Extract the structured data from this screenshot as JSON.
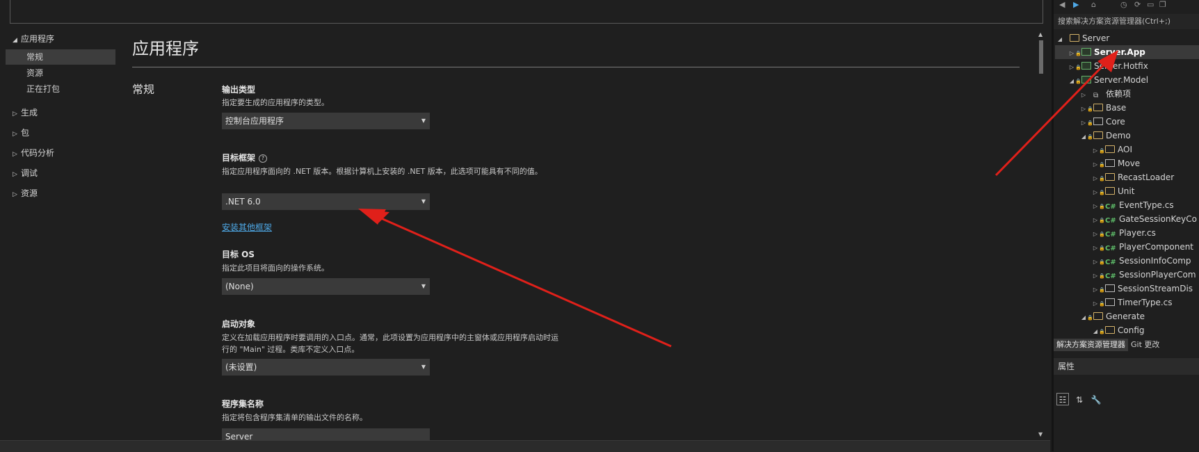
{
  "nav": {
    "app": "应用程序",
    "app_items": [
      "常规",
      "资源",
      "正在打包"
    ],
    "groups": [
      "生成",
      "包",
      "代码分析",
      "调试",
      "资源"
    ]
  },
  "content": {
    "page_title": "应用程序",
    "section_title": "常规",
    "output_type_label": "输出类型",
    "output_type_desc": "指定要生成的应用程序的类型。",
    "output_type_value": "控制台应用程序",
    "target_fw_label": "目标框架",
    "target_fw_desc": "指定应用程序面向的 .NET 版本。根据计算机上安装的 .NET 版本，此选项可能具有不同的值。",
    "target_fw_value": ".NET 6.0",
    "install_link": "安装其他框架",
    "target_os_label": "目标 OS",
    "target_os_desc": "指定此项目将面向的操作系统。",
    "target_os_value": "(None)",
    "startup_label": "启动对象",
    "startup_desc": "定义在加载应用程序时要调用的入口点。通常，此项设置为应用程序中的主窗体或应用程序启动时运行的 \"Main\" 过程。类库不定义入口点。",
    "startup_value": "(未设置)",
    "assembly_label": "程序集名称",
    "assembly_desc": "指定将包含程序集清单的输出文件的名称。",
    "assembly_value": "Server"
  },
  "solution": {
    "search_placeholder": "搜索解决方案资源管理器(Ctrl+;)",
    "tree": [
      {
        "label": "Server",
        "icon": "folder-open-icon",
        "arrow": "▲",
        "level": 0,
        "lock": false
      },
      {
        "label": "Server.App",
        "icon": "project-icon",
        "arrow": "▷",
        "level": 1,
        "lock": true,
        "bold": true,
        "selected": true
      },
      {
        "label": "Server.Hotfix",
        "icon": "project-icon",
        "arrow": "▷",
        "level": 1,
        "lock": true
      },
      {
        "label": "Server.Model",
        "icon": "project-icon",
        "arrow": "▲",
        "level": 1,
        "lock": true
      },
      {
        "label": "依赖项",
        "icon": "dependencies-icon",
        "arrow": "▷",
        "level": 2,
        "lock": false
      },
      {
        "label": "Base",
        "icon": "folder-icon",
        "arrow": "▷",
        "level": 2,
        "lock": true
      },
      {
        "label": "Core",
        "icon": "file-icon",
        "arrow": "▷",
        "level": 2,
        "lock": true
      },
      {
        "label": "Demo",
        "icon": "folder-open-icon",
        "arrow": "▲",
        "level": 2,
        "lock": true
      },
      {
        "label": "AOI",
        "icon": "folder-icon",
        "arrow": "▷",
        "level": 3,
        "lock": true
      },
      {
        "label": "Move",
        "icon": "file-icon",
        "arrow": "▷",
        "level": 3,
        "lock": true
      },
      {
        "label": "RecastLoader",
        "icon": "folder-icon",
        "arrow": "▷",
        "level": 3,
        "lock": true
      },
      {
        "label": "Unit",
        "icon": "folder-icon",
        "arrow": "▷",
        "level": 3,
        "lock": true
      },
      {
        "label": "EventType.cs",
        "icon": "csharp-icon",
        "arrow": "▷",
        "level": 3,
        "lock": true
      },
      {
        "label": "GateSessionKeyCo",
        "icon": "csharp-icon",
        "arrow": "▷",
        "level": 3,
        "lock": true
      },
      {
        "label": "Player.cs",
        "icon": "csharp-icon",
        "arrow": "▷",
        "level": 3,
        "lock": true
      },
      {
        "label": "PlayerComponent",
        "icon": "csharp-icon",
        "arrow": "▷",
        "level": 3,
        "lock": true
      },
      {
        "label": "SessionInfoComp",
        "icon": "csharp-icon",
        "arrow": "▷",
        "level": 3,
        "lock": true
      },
      {
        "label": "SessionPlayerCom",
        "icon": "csharp-icon",
        "arrow": "▷",
        "level": 3,
        "lock": true
      },
      {
        "label": "SessionStreamDis",
        "icon": "file-icon",
        "arrow": "▷",
        "level": 3,
        "lock": true
      },
      {
        "label": "TimerType.cs",
        "icon": "file-icon",
        "arrow": "▷",
        "level": 3,
        "lock": true
      },
      {
        "label": "Generate",
        "icon": "folder-open-icon",
        "arrow": "▲",
        "level": 2,
        "lock": true
      },
      {
        "label": "Config",
        "icon": "folder-open-icon",
        "arrow": "▲",
        "level": 3,
        "lock": true
      }
    ],
    "tabs": [
      "解决方案资源管理器",
      "Git 更改"
    ]
  },
  "properties": {
    "title": "属性"
  },
  "colors": {
    "arrow": "#e0201a",
    "link": "#4ea8e6",
    "background": "#1f1f1f"
  }
}
